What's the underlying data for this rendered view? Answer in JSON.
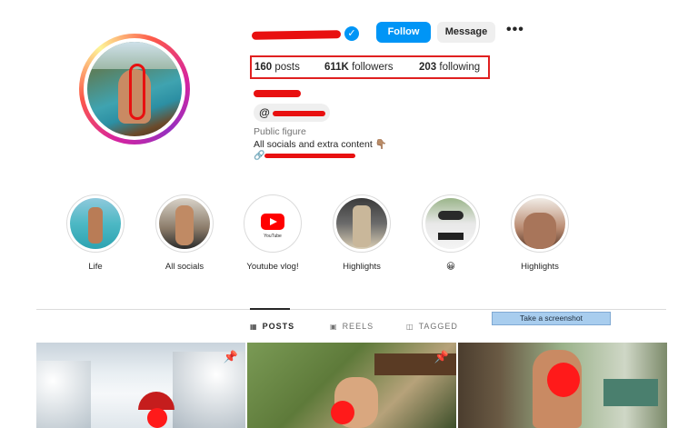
{
  "profile": {
    "verified_icon": "verified-badge-icon",
    "follow_label": "Follow",
    "message_label": "Message",
    "more_label": "•••",
    "stats": {
      "posts_count": "160",
      "posts_label": "posts",
      "followers_count": "611K",
      "followers_label": "followers",
      "following_count": "203",
      "following_label": "following"
    },
    "category": "Public figure",
    "bio": "All socials and extra content 👇🏽"
  },
  "highlights": [
    {
      "label": "Life"
    },
    {
      "label": "All socials"
    },
    {
      "label": "Youtube vlog!",
      "thumb_text": "YouTube"
    },
    {
      "label": "Highlights"
    },
    {
      "label": "😀"
    },
    {
      "label": "Highlights"
    }
  ],
  "tabs": [
    {
      "label": "POSTS",
      "icon": "grid-icon",
      "active": true
    },
    {
      "label": "REELS",
      "icon": "reels-icon",
      "active": false
    },
    {
      "label": "TAGGED",
      "icon": "tagged-icon",
      "active": false
    }
  ],
  "tooltip": "Take a screenshot",
  "colors": {
    "accent": "#0095f6",
    "redaction": "#e81010",
    "highlight_box": "#e02020"
  }
}
